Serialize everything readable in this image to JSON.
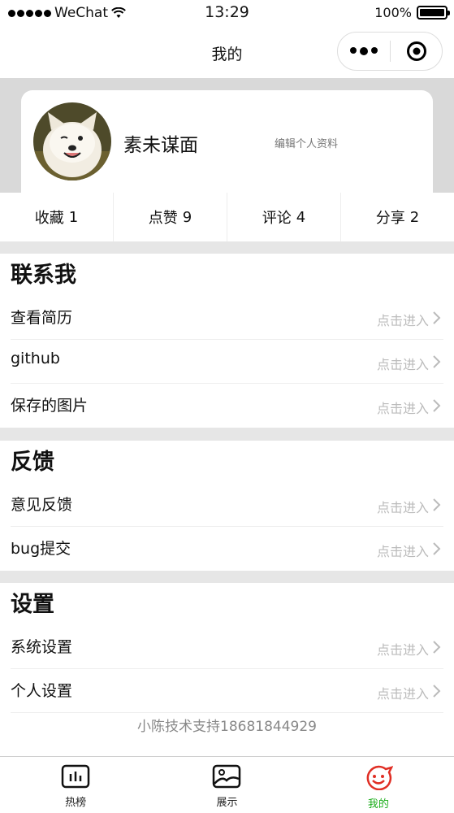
{
  "status_bar": {
    "carrier": "WeChat",
    "time": "13:29",
    "battery": "100%"
  },
  "nav": {
    "title": "我的"
  },
  "profile": {
    "name": "素未谋面",
    "edit_label": "编辑个人资料"
  },
  "stats": [
    {
      "label": "收藏",
      "count": "1"
    },
    {
      "label": "点赞",
      "count": "9"
    },
    {
      "label": "评论",
      "count": "4"
    },
    {
      "label": "分享",
      "count": "2"
    }
  ],
  "sections": [
    {
      "title": "联系我",
      "items": [
        {
          "label": "查看简历",
          "action": "点击进入"
        },
        {
          "label": "github",
          "action": "点击进入"
        },
        {
          "label": "保存的图片",
          "action": "点击进入"
        }
      ]
    },
    {
      "title": "反馈",
      "items": [
        {
          "label": "意见反馈",
          "action": "点击进入"
        },
        {
          "label": "bug提交",
          "action": "点击进入"
        }
      ]
    },
    {
      "title": "设置",
      "items": [
        {
          "label": "系统设置",
          "action": "点击进入"
        },
        {
          "label": "个人设置",
          "action": "点击进入"
        }
      ]
    }
  ],
  "footer": {
    "text": "小陈技术支持18681844929"
  },
  "tab_bar": [
    {
      "label": "热榜",
      "icon": "chart-icon",
      "active": false
    },
    {
      "label": "展示",
      "icon": "image-icon",
      "active": false
    },
    {
      "label": "我的",
      "icon": "smiley-icon",
      "active": true
    }
  ],
  "colors": {
    "active_tab": "#1aad19",
    "active_icon": "#e02e24",
    "muted": "#bbbbbb"
  }
}
